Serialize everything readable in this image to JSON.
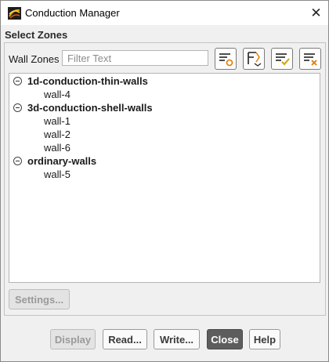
{
  "window": {
    "title": "Conduction Manager",
    "close_glyph": "✕"
  },
  "select_zones": {
    "label": "Select Zones",
    "wall_zones_label": "Wall Zones",
    "filter_placeholder": "Filter Text",
    "filter_value": ""
  },
  "toolbar": {
    "buttons": [
      {
        "icon": "filter-options-icon"
      },
      {
        "icon": "sort-filter-icon"
      },
      {
        "icon": "select-all-icon"
      },
      {
        "icon": "deselect-all-icon"
      }
    ]
  },
  "tree": {
    "groups": [
      {
        "label": "1d-conduction-thin-walls",
        "expanded": true,
        "items": [
          "wall-4"
        ]
      },
      {
        "label": "3d-conduction-shell-walls",
        "expanded": true,
        "items": [
          "wall-1",
          "wall-2",
          "wall-6"
        ]
      },
      {
        "label": "ordinary-walls",
        "expanded": true,
        "items": [
          "wall-5"
        ]
      }
    ]
  },
  "settings_button": {
    "label": "Settings...",
    "enabled": false
  },
  "footer": {
    "buttons": [
      {
        "label": "Display",
        "enabled": false
      },
      {
        "label": "Read...",
        "enabled": true
      },
      {
        "label": "Write...",
        "enabled": true
      },
      {
        "label": "Close",
        "enabled": true,
        "primary": true
      },
      {
        "label": "Help",
        "enabled": true
      }
    ]
  },
  "colors": {
    "dialog_bg": "#f0f0f0",
    "primary_button": "#5d5d5d",
    "icon_accent": "#e07b00",
    "icon_ok": "#d4a000"
  }
}
